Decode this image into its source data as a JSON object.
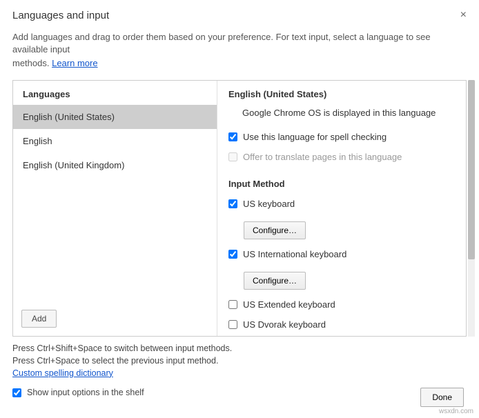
{
  "header": {
    "title": "Languages and input",
    "close_glyph": "×",
    "subtitle_a": "Add languages and drag to order them based on your preference. For text input, select a language to see available input",
    "subtitle_b": "methods. ",
    "learn_more": "Learn more"
  },
  "left": {
    "heading": "Languages",
    "items": [
      {
        "label": "English (United States)",
        "selected": true
      },
      {
        "label": "English",
        "selected": false
      },
      {
        "label": "English (United Kingdom)",
        "selected": false
      }
    ],
    "add_label": "Add"
  },
  "right": {
    "title": "English (United States)",
    "display_note": "Google Chrome OS is displayed in this language",
    "spell_check": {
      "label": "Use this language for spell checking",
      "checked": true
    },
    "translate": {
      "label": "Offer to translate pages in this language",
      "checked": false
    },
    "input_method_heading": "Input Method",
    "methods": [
      {
        "label": "US keyboard",
        "checked": true,
        "configure": "Configure…"
      },
      {
        "label": "US International keyboard",
        "checked": true,
        "configure": "Configure…"
      },
      {
        "label": "US Extended keyboard",
        "checked": false
      },
      {
        "label": "US Dvorak keyboard",
        "checked": false
      }
    ]
  },
  "footer": {
    "line1": "Press Ctrl+Shift+Space to switch between input methods.",
    "line2": "Press Ctrl+Space to select the previous input method.",
    "dict_link": "Custom spelling dictionary",
    "shelf_opt": {
      "label": "Show input options in the shelf",
      "checked": true
    },
    "done": "Done"
  },
  "attrib": "wsxdn.com"
}
